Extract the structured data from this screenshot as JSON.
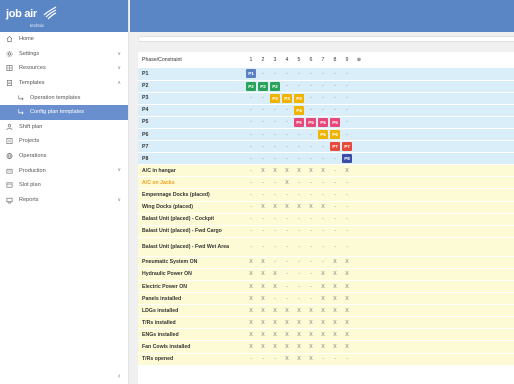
{
  "logo": {
    "main": "job air",
    "sub": "technic"
  },
  "sidebar": {
    "items": [
      {
        "label": "Home",
        "icon": "home-icon"
      },
      {
        "label": "Settings",
        "icon": "gear-icon",
        "chevron": "∨"
      },
      {
        "label": "Resources",
        "icon": "resources-icon",
        "chevron": "∨"
      },
      {
        "label": "Templates",
        "icon": "templates-icon",
        "chevron": "∧"
      },
      {
        "label": "Operation templates",
        "icon": "sub-arrow-icon",
        "sub": true
      },
      {
        "label": "Config plan templates",
        "icon": "sub-arrow-icon",
        "sub": true,
        "active": true
      },
      {
        "label": "Shift plan",
        "icon": "person-icon"
      },
      {
        "label": "Projects",
        "icon": "projects-icon"
      },
      {
        "label": "Operations",
        "icon": "operations-icon"
      },
      {
        "label": "Production",
        "icon": "production-icon",
        "chevron": "∨"
      },
      {
        "label": "Slot plan",
        "icon": "slot-plan-icon"
      },
      {
        "label": "Reports",
        "icon": "reports-icon",
        "chevron": "∨"
      }
    ],
    "collapse": "‹"
  },
  "grid": {
    "header_label": "Phase/Constraint",
    "columns": [
      "1",
      "2",
      "3",
      "4",
      "5",
      "6",
      "7",
      "8",
      "9"
    ],
    "highlight_column": "6",
    "add_symbol": "⊕",
    "phase_colors": {
      "P1": "#5b7fc4",
      "P2": "#2aa35a",
      "P3": "#f0b400",
      "P4": "#f0b400",
      "P5": "#e8477a",
      "P6": "#f0b400",
      "P7": "#e64a3c",
      "P8": "#3a4ea8"
    },
    "phases": [
      {
        "label": "P1",
        "cells": [
          "P1",
          "-",
          "-",
          "-",
          "-",
          "-",
          "-",
          "-",
          "-"
        ]
      },
      {
        "label": "P2",
        "cells": [
          "P2",
          "P2",
          "P2",
          "-",
          "-",
          "-",
          "-",
          "-",
          "-"
        ]
      },
      {
        "label": "P3",
        "cells": [
          "-",
          "-",
          "P3",
          "P3",
          "P3",
          "-",
          "-",
          "-",
          "-"
        ]
      },
      {
        "label": "P4",
        "cells": [
          "-",
          "-",
          "-",
          "-",
          "P4",
          "-",
          "-",
          "-",
          "-"
        ]
      },
      {
        "label": "P5",
        "cells": [
          "-",
          "-",
          "-",
          "-",
          "P5",
          "P5",
          "P5",
          "P5",
          "-"
        ]
      },
      {
        "label": "P6",
        "cells": [
          "-",
          "-",
          "-",
          "-",
          "-",
          "-",
          "P6",
          "P6",
          "-"
        ]
      },
      {
        "label": "P7",
        "cells": [
          "-",
          "-",
          "-",
          "-",
          "-",
          "-",
          "-",
          "P7",
          "P7"
        ]
      },
      {
        "label": "P8",
        "cells": [
          "-",
          "-",
          "-",
          "-",
          "-",
          "-",
          "-",
          "-",
          "P8"
        ]
      }
    ],
    "constraints": [
      {
        "label": "A/C in hangar",
        "cells": [
          "-",
          "X",
          "X",
          "X",
          "X",
          "X",
          "X",
          "-",
          "X"
        ]
      },
      {
        "label": "A/C on Jacks",
        "orange": true,
        "cells": [
          "-",
          "-",
          "-",
          "X",
          "-",
          "-",
          "-",
          "-",
          "-"
        ]
      },
      {
        "label": "Empennage Docks (placed)",
        "cells": [
          "-",
          "-",
          "-",
          "-",
          "-",
          "-",
          "-",
          "-",
          "-"
        ]
      },
      {
        "label": "Wing Docks (placed)",
        "cells": [
          "-",
          "X",
          "X",
          "X",
          "X",
          "X",
          "X",
          "-",
          "-"
        ]
      },
      {
        "label": "Balast Unit (placed) - Cockpit",
        "cells": [
          "-",
          "-",
          "-",
          "-",
          "-",
          "-",
          "-",
          "-",
          "-"
        ]
      },
      {
        "label": "Balast Unit (placed) - Fwd Cargo",
        "cells": [
          "-",
          "-",
          "-",
          "-",
          "-",
          "-",
          "-",
          "-",
          "-"
        ]
      },
      {
        "label": "Balast Unit (placed) - Fwd Wet Area",
        "tall": true,
        "cells": [
          "-",
          "-",
          "-",
          "-",
          "-",
          "-",
          "-",
          "-",
          "-"
        ]
      },
      {
        "label": "Pneumatic System ON",
        "cells": [
          "X",
          "X",
          "-",
          "-",
          "-",
          "-",
          "-",
          "X",
          "X"
        ]
      },
      {
        "label": "Hydraulic Power ON",
        "cells": [
          "X",
          "X",
          "X",
          "-",
          "-",
          "-",
          "X",
          "X",
          "X"
        ]
      },
      {
        "label": "Electric Power ON",
        "cells": [
          "X",
          "X",
          "X",
          "-",
          "-",
          "-",
          "X",
          "X",
          "X"
        ]
      },
      {
        "label": "Panels installed",
        "cells": [
          "X",
          "X",
          "-",
          "-",
          "-",
          "-",
          "X",
          "X",
          "X"
        ]
      },
      {
        "label": "LDGs installed",
        "cells": [
          "X",
          "X",
          "X",
          "X",
          "X",
          "X",
          "X",
          "X",
          "X"
        ]
      },
      {
        "label": "T/Rs installed",
        "cells": [
          "X",
          "X",
          "X",
          "X",
          "X",
          "X",
          "X",
          "X",
          "X"
        ]
      },
      {
        "label": "ENGs installed",
        "cells": [
          "X",
          "X",
          "X",
          "X",
          "X",
          "X",
          "X",
          "X",
          "X"
        ]
      },
      {
        "label": "Fan Cowls installed",
        "cells": [
          "X",
          "X",
          "X",
          "X",
          "X",
          "X",
          "X",
          "X",
          "X"
        ]
      },
      {
        "label": "T/Rs opened",
        "cells": [
          "-",
          "-",
          "-",
          "X",
          "X",
          "X",
          "-",
          "-",
          "-"
        ]
      }
    ]
  }
}
